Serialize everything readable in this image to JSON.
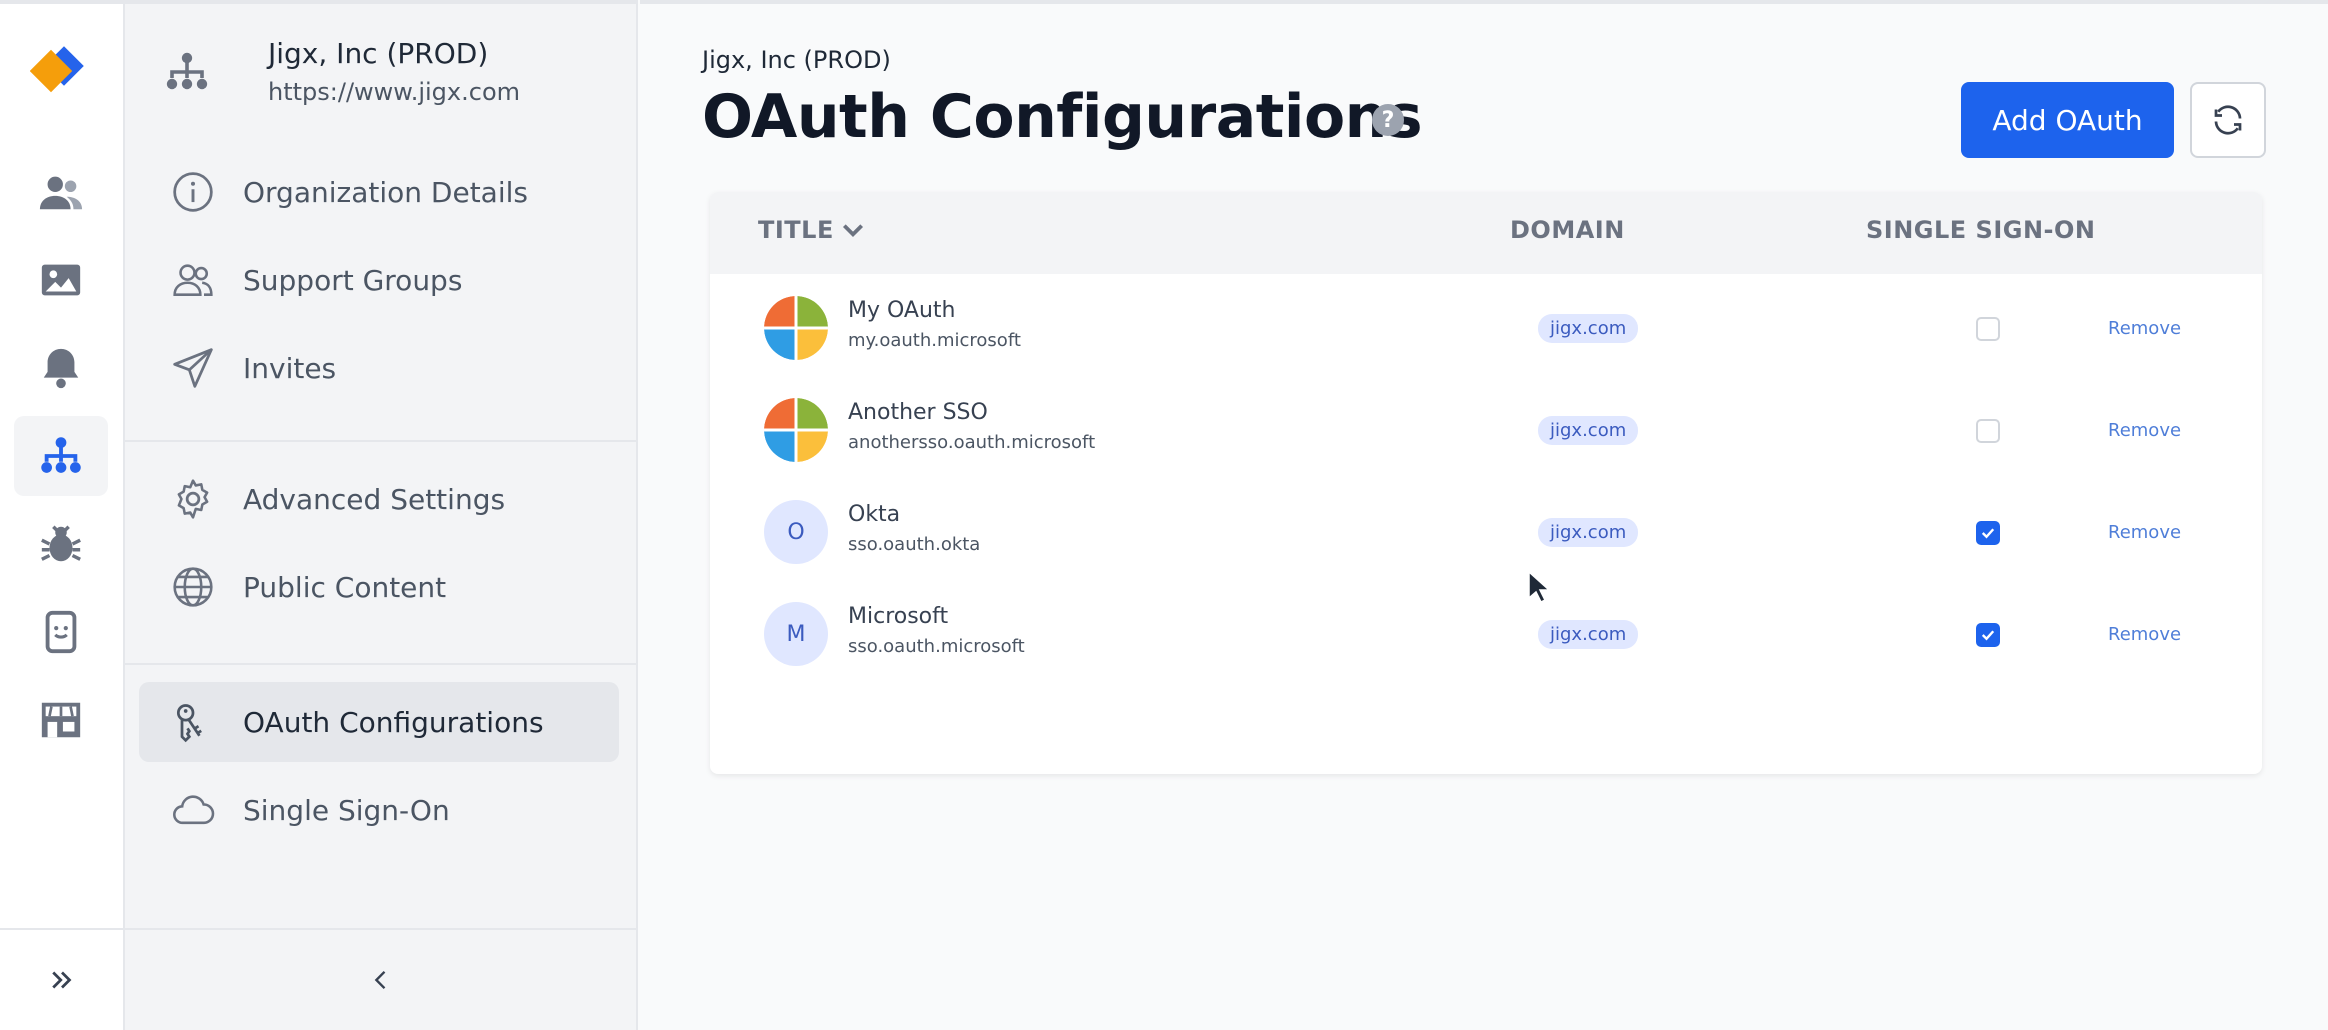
{
  "colors": {
    "accent": "#1d63ed",
    "rail_active": "#2563eb",
    "icon": "#6b7280"
  },
  "rail": {
    "items": [
      {
        "icon": "users-icon"
      },
      {
        "icon": "image-folder-icon"
      },
      {
        "icon": "bell-icon"
      },
      {
        "icon": "org-chart-icon",
        "active": true
      },
      {
        "icon": "bug-icon"
      },
      {
        "icon": "phone-smile-icon"
      },
      {
        "icon": "store-icon"
      }
    ],
    "expand_icon": "double-chevron-right-icon"
  },
  "sidebar": {
    "org_name": "Jigx, Inc (PROD)",
    "org_url": "https://www.jigx.com",
    "items": [
      {
        "label": "Organization Details",
        "icon": "info-icon"
      },
      {
        "label": "Support Groups",
        "icon": "users-outline-icon"
      },
      {
        "label": "Invites",
        "icon": "paper-plane-icon"
      },
      {
        "label": "Advanced Settings",
        "icon": "gear-icon"
      },
      {
        "label": "Public Content",
        "icon": "globe-icon"
      },
      {
        "label": "OAuth Configurations",
        "icon": "keys-icon",
        "active": true
      },
      {
        "label": "Single Sign-On",
        "icon": "cloud-icon"
      }
    ],
    "collapse_icon": "chevron-left-icon"
  },
  "main": {
    "breadcrumb": "Jigx, Inc (PROD)",
    "title": "OAuth Configurations",
    "help": "?",
    "add_button": "Add OAuth",
    "columns": {
      "title": "TITLE",
      "domain": "DOMAIN",
      "sso": "SINGLE SIGN-ON"
    },
    "rows": [
      {
        "name": "My OAuth",
        "id": "my.oauth.microsoft",
        "domain": "jigx.com",
        "sso": false,
        "avatar": "microsoft-logo",
        "action": "Remove"
      },
      {
        "name": "Another SSO",
        "id": "anothersso.oauth.microsoft",
        "domain": "jigx.com",
        "sso": false,
        "avatar": "microsoft-logo",
        "action": "Remove"
      },
      {
        "name": "Okta",
        "id": "sso.oauth.okta",
        "domain": "jigx.com",
        "sso": true,
        "avatar": "O",
        "action": "Remove"
      },
      {
        "name": "Microsoft",
        "id": "sso.oauth.microsoft",
        "domain": "jigx.com",
        "sso": true,
        "avatar": "M",
        "action": "Remove"
      }
    ]
  }
}
